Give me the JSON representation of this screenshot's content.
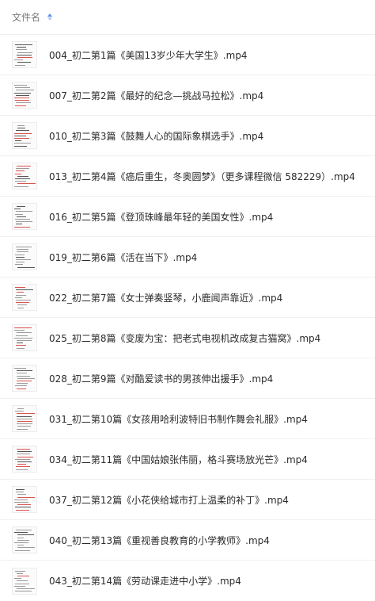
{
  "header": {
    "column_label": "文件名",
    "sort_icon": "sort-ascending-icon"
  },
  "files": [
    {
      "name": "004_初二第1篇《美国13岁少年大学生》.mp4",
      "icon": "video-thumbnail-icon"
    },
    {
      "name": "007_初二第2篇《最好的纪念—挑战马拉松》.mp4",
      "icon": "video-thumbnail-icon"
    },
    {
      "name": "010_初二第3篇《鼓舞人心的国际象棋选手》.mp4",
      "icon": "video-thumbnail-icon"
    },
    {
      "name": "013_初二第4篇《癌后重生，冬奥圆梦》（更多课程微信 582229）.mp4",
      "icon": "video-thumbnail-icon"
    },
    {
      "name": "016_初二第5篇《登顶珠峰最年轻的美国女性》.mp4",
      "icon": "video-thumbnail-icon"
    },
    {
      "name": "019_初二第6篇《活在当下》.mp4",
      "icon": "video-thumbnail-icon"
    },
    {
      "name": "022_初二第7篇《女士弹奏竖琴，小鹿闻声靠近》.mp4",
      "icon": "video-thumbnail-icon"
    },
    {
      "name": "025_初二第8篇《变废为宝：把老式电视机改成复古猫窝》.mp4",
      "icon": "video-thumbnail-icon"
    },
    {
      "name": "028_初二第9篇《对酷爱读书的男孩伸出援手》.mp4",
      "icon": "video-thumbnail-icon"
    },
    {
      "name": "031_初二第10篇《女孩用哈利波特旧书制作舞会礼服》.mp4",
      "icon": "video-thumbnail-icon"
    },
    {
      "name": "034_初二第11篇《中国姑娘张伟丽，格斗赛场放光芒》.mp4",
      "icon": "video-thumbnail-icon"
    },
    {
      "name": "037_初二第12篇《小花侠给城市打上温柔的补丁》.mp4",
      "icon": "video-thumbnail-icon"
    },
    {
      "name": "040_初二第13篇《重视善良教育的小学教师》.mp4",
      "icon": "video-thumbnail-icon"
    },
    {
      "name": "043_初二第14篇《劳动课走进中小学》.mp4",
      "icon": "video-thumbnail-icon"
    }
  ],
  "colors": {
    "sort_accent": "#5b8def",
    "text": "#2b2b2b",
    "header_text": "#7a7a7a",
    "divider": "#f0f0f0"
  }
}
